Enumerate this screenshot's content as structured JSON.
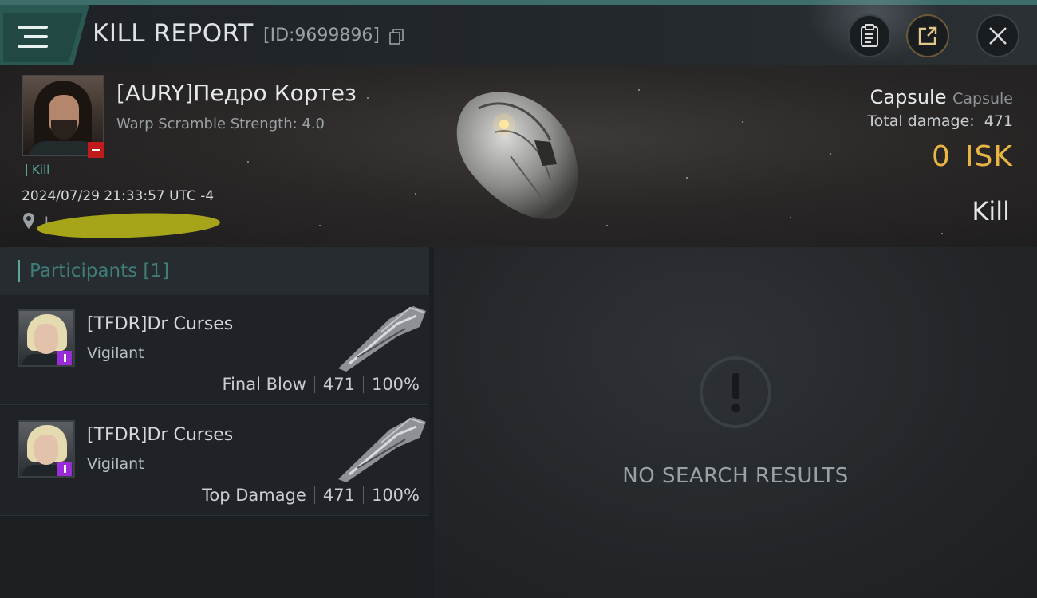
{
  "header": {
    "title": "KILL REPORT",
    "report_id": "[ID:9699896]",
    "icons": [
      "menu-icon",
      "copy-icon",
      "clipboard-icon",
      "share-icon",
      "close-icon"
    ]
  },
  "victim": {
    "name": "[AURY]Педро Кортез",
    "warp_scramble": "Warp Scramble Strength: 4.0",
    "tag": "Kill",
    "datetime": "2024/07/29 21:33:57 UTC -4",
    "location": "L",
    "ship_type": "Capsule",
    "ship_name": "Capsule",
    "total_damage_label": "Total damage:",
    "total_damage": "471",
    "isk_value": "0",
    "isk_unit": "ISK",
    "result": "Kill"
  },
  "participants": {
    "title": "Participants [1]",
    "rows": [
      {
        "name": "[TFDR]Dr Curses",
        "ship": "Vigilant",
        "role": "Final Blow",
        "damage": "471",
        "percent": "100%"
      },
      {
        "name": "[TFDR]Dr Curses",
        "ship": "Vigilant",
        "role": "Top Damage",
        "damage": "471",
        "percent": "100%"
      }
    ]
  },
  "results": {
    "empty_text": "NO SEARCH RESULTS"
  },
  "colors": {
    "accent": "#5aa79d",
    "isk": "#e8b544",
    "danger": "#c11a1a",
    "badge": "#9a2bd8"
  }
}
